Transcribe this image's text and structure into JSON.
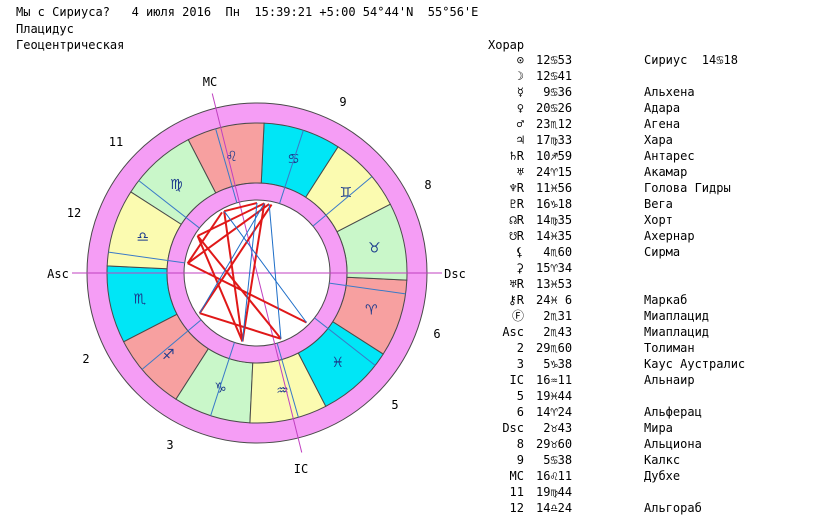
{
  "header": {
    "line1": "Мы с Сириуса?   4 июля 2016  Пн  15:39:21 +5:00 54°44'N  55°56'E",
    "line2": "Плацидус",
    "line3": "Геоцентрическая"
  },
  "chart_labels": {
    "mc": "MC",
    "ic": "IC",
    "asc": "Asc",
    "dsc": "Dsc",
    "houses": [
      "9",
      "8",
      "6",
      "5",
      "3",
      "2",
      "12",
      "11"
    ]
  },
  "table": {
    "title": "Хорар",
    "rows": [
      {
        "planet": "⊙",
        "position": "12♋53",
        "star": "Сириус  14♋18"
      },
      {
        "planet": "☽",
        "position": "12♋41",
        "star": ""
      },
      {
        "planet": "☿",
        "position": " 9♋36",
        "star": "Альхена"
      },
      {
        "planet": "♀",
        "position": "20♋26",
        "star": "Адара"
      },
      {
        "planet": "♂",
        "position": "23♏12",
        "star": "Агена"
      },
      {
        "planet": "♃",
        "position": "17♍33",
        "star": "Хара"
      },
      {
        "planet": "♄R",
        "position": "10♐59",
        "star": "Антарес"
      },
      {
        "planet": "♅",
        "position": "24♈15",
        "star": "Акамар"
      },
      {
        "planet": "♆R",
        "position": "11♓56",
        "star": "Голова Гидры"
      },
      {
        "planet": "♇R",
        "position": "16♑18",
        "star": "Вега"
      },
      {
        "planet": "☊R",
        "position": "14♍35",
        "star": "Хорт"
      },
      {
        "planet": "☋R",
        "position": "14♓35",
        "star": "Ахернар"
      },
      {
        "planet": "⚸",
        "position": " 4♏60",
        "star": "Сирма"
      },
      {
        "planet": "⚳",
        "position": "15♈34",
        "star": ""
      },
      {
        "planet": "♅R",
        "position": "13♓53",
        "star": ""
      },
      {
        "planet": "⚷R",
        "position": "24♓ 6",
        "star": "Маркаб"
      },
      {
        "planet": "Ⓕ",
        "position": " 2♏31",
        "star": "Миаплацид"
      },
      {
        "planet": "Asc",
        "position": " 2♏43",
        "star": "Миаплацид"
      },
      {
        "planet": "2",
        "position": "29♏60",
        "star": "Толиман"
      },
      {
        "planet": "3",
        "position": " 5♑38",
        "star": "Каус Аустралис"
      },
      {
        "planet": "IC",
        "position": "16♒11",
        "star": "Альнаир"
      },
      {
        "planet": "5",
        "position": "19♓44",
        "star": ""
      },
      {
        "planet": "6",
        "position": "14♈24",
        "star": "Альферац"
      },
      {
        "planet": "Dsc",
        "position": " 2♉43",
        "star": "Мира"
      },
      {
        "planet": "8",
        "position": "29♉60",
        "star": "Альциона"
      },
      {
        "planet": "9",
        "position": " 5♋38",
        "star": "Калкс"
      },
      {
        "planet": "MC",
        "position": "16♌11",
        "star": "Дубхе"
      },
      {
        "planet": "11",
        "position": "19♍44",
        "star": ""
      },
      {
        "planet": "12",
        "position": "14♎24",
        "star": "Альгораб"
      }
    ]
  },
  "colors": {
    "outer_ring": "#f59df5",
    "fire": "#f7a0a0",
    "earth": "#c9f7c9",
    "air": "#fbfbb0",
    "water": "#00e6f6",
    "aspect_red": "#e01818",
    "aspect_blue": "#1e6ec8"
  }
}
